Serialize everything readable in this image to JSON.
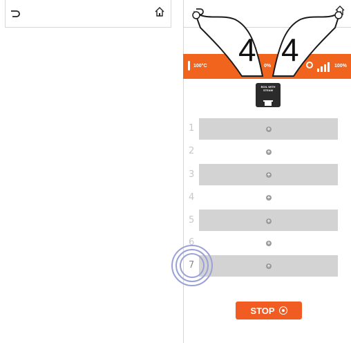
{
  "status_bar": {
    "temperature": "100°C",
    "humidity": "0%",
    "power": "100%"
  },
  "program": {
    "label": "BOIL WITH STEAM"
  },
  "steps": [
    {
      "number": "1"
    },
    {
      "number": "2"
    },
    {
      "number": "3"
    },
    {
      "number": "4"
    },
    {
      "number": "5"
    },
    {
      "number": "6"
    },
    {
      "number": "7"
    }
  ],
  "stop_button": {
    "label": "STOP"
  },
  "gesture": {
    "tap_count_left": "4",
    "tap_count_right": "4"
  },
  "colors": {
    "accent": "#f0641e",
    "row_fill": "#d3d3d3",
    "touch_ring": "#9aa1d6"
  },
  "icons": [
    "back-icon",
    "home-icon",
    "thermometer-icon",
    "fan-icon",
    "signal-bars-icon",
    "pot-icon",
    "plus-icon",
    "stop-icon"
  ]
}
